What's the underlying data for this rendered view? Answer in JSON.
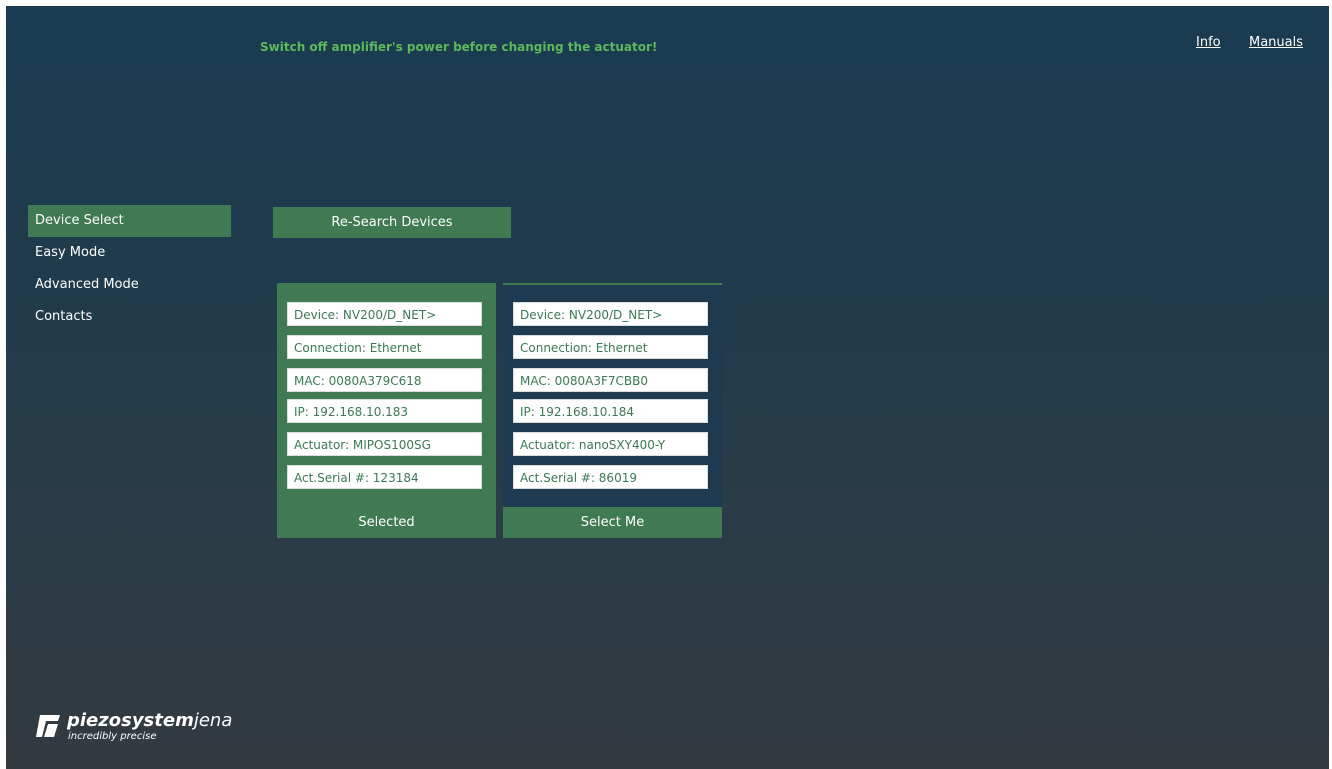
{
  "header": {
    "warning": "Switch off amplifier's power before changing the actuator!",
    "info_link": "Info",
    "manuals_link": "Manuals"
  },
  "sidebar": {
    "items": [
      {
        "label": "Device Select",
        "active": true
      },
      {
        "label": "Easy Mode",
        "active": false
      },
      {
        "label": "Advanced Mode",
        "active": false
      },
      {
        "label": "Contacts",
        "active": false
      }
    ]
  },
  "main": {
    "research_label": "Re-Search Devices",
    "devices": [
      {
        "device": "Device: NV200/D_NET>",
        "connection": "Connection: Ethernet",
        "mac": "MAC: 0080A379C618",
        "ip": "IP: 192.168.10.183",
        "actuator": "Actuator: MIPOS100SG",
        "serial": "Act.Serial #: 123184",
        "button": "Selected",
        "selected": true
      },
      {
        "device": "Device: NV200/D_NET>",
        "connection": "Connection: Ethernet",
        "mac": "MAC: 0080A3F7CBB0",
        "ip": "IP: 192.168.10.184",
        "actuator": "Actuator: nanoSXY400-Y",
        "serial": "Act.Serial #: 86019",
        "button": "Select Me",
        "selected": false
      }
    ]
  },
  "logo": {
    "brand_bold": "piezosystem",
    "brand_light": "jena",
    "tagline": "incredibly precise"
  },
  "colors": {
    "accent_green": "#3f7a52",
    "warning_text": "#5cb85c",
    "panel_blue": "#1d3a51"
  }
}
